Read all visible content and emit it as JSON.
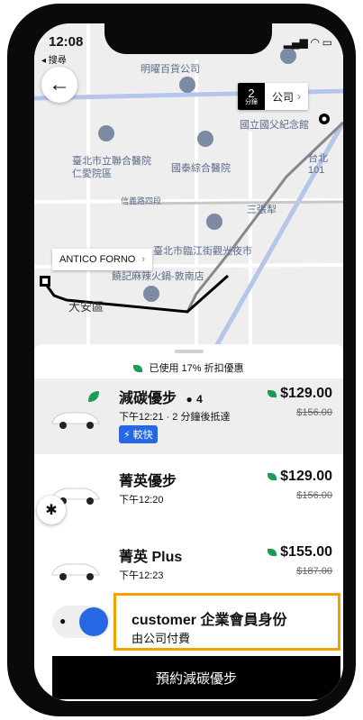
{
  "status": {
    "time": "12:08",
    "back_label": "◂ 搜尋"
  },
  "map": {
    "eta_num": "2",
    "eta_unit": "分鐘",
    "destination": "公司",
    "pickup_label": "ANTICO FORNO",
    "places": [
      "明曜百貨公司",
      "臺北市立聯合醫院仁愛院區",
      "國泰綜合醫院",
      "國立國父紀念館",
      "台北101",
      "信義路四段",
      "三張犁",
      "臺北市臨江街觀光夜市",
      "饒記麻辣火鍋-敦南店",
      "大安區"
    ]
  },
  "panel": {
    "discount": "已使用 17% 折扣優惠",
    "rides": [
      {
        "name": "減碳優步",
        "seats": "4",
        "sub": "下午12:21 · 2 分鐘後抵達",
        "badge": "較快",
        "price": "$129.00",
        "old": "$156.00"
      },
      {
        "name": "菁英優步",
        "sub": "下午12:20",
        "price": "$129.00",
        "old": "$156.00"
      },
      {
        "name": "菁英 Plus",
        "sub": "下午12:23",
        "price": "$155.00",
        "old": "$187.00"
      }
    ],
    "corp_title": "customer 企業會員身份",
    "corp_sub": "由公司付費",
    "book_button": "預約減碳優步"
  }
}
